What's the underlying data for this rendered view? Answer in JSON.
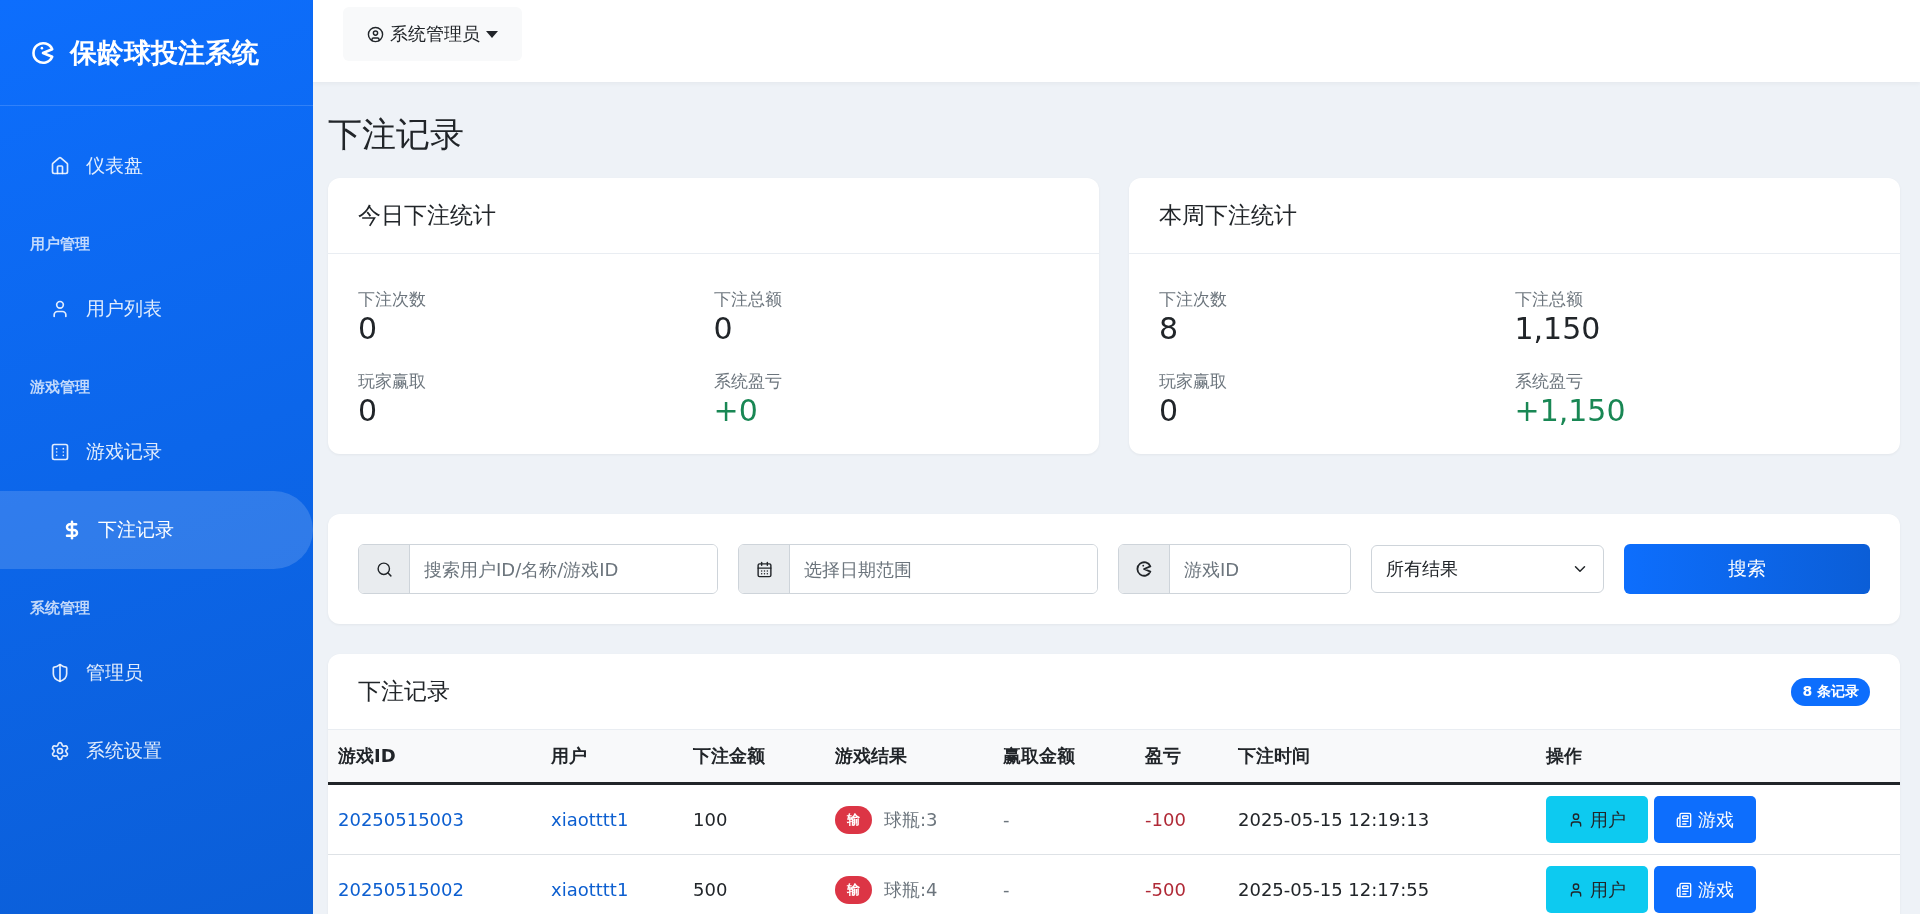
{
  "sidebar": {
    "brand": "保龄球投注系统",
    "sections": [
      {
        "items": [
          {
            "label": "仪表盘",
            "selected": false
          }
        ]
      },
      {
        "heading": "用户管理",
        "items": [
          {
            "label": "用户列表",
            "selected": false
          }
        ]
      },
      {
        "heading": "游戏管理",
        "items": [
          {
            "label": "游戏记录",
            "selected": false
          },
          {
            "label": "下注记录",
            "selected": true
          }
        ]
      },
      {
        "heading": "系统管理",
        "items": [
          {
            "label": "管理员",
            "selected": false
          },
          {
            "label": "系统设置",
            "selected": false
          }
        ]
      }
    ]
  },
  "topbar": {
    "user_menu": "系统管理员"
  },
  "page_title": "下注记录",
  "stat_cards": [
    {
      "title": "今日下注统计",
      "stats": [
        {
          "label": "下注次数",
          "value": "0"
        },
        {
          "label": "下注总额",
          "value": "0"
        },
        {
          "label": "玩家赢取",
          "value": "0"
        },
        {
          "label": "系统盈亏",
          "value": "+0",
          "color": "#198754"
        }
      ]
    },
    {
      "title": "本周下注统计",
      "stats": [
        {
          "label": "下注次数",
          "value": "8"
        },
        {
          "label": "下注总额",
          "value": "1,150"
        },
        {
          "label": "玩家赢取",
          "value": "0"
        },
        {
          "label": "系统盈亏",
          "value": "+1,150",
          "color": "#198754"
        }
      ]
    }
  ],
  "filters": {
    "search": {
      "placeholder": "搜索用户ID/名称/游戏ID"
    },
    "date": {
      "placeholder": "选择日期范围"
    },
    "game_id": {
      "placeholder": "游戏ID"
    },
    "result_select": "所有结果",
    "search_button": "搜索"
  },
  "table": {
    "title": "下注记录",
    "count_badge": "8 条记录",
    "columns": [
      "游戏ID",
      "用户",
      "下注金额",
      "游戏结果",
      "赢取金额",
      "盈亏",
      "下注时间",
      "操作"
    ],
    "rows": [
      {
        "game_id": "20250515003",
        "user": "xiaotttt1",
        "amount": "100",
        "result": {
          "badge": "输",
          "color": "#dc3545",
          "detail": "球瓶:3"
        },
        "win": "-",
        "profit": {
          "text": "-100",
          "color": "#b02a37"
        },
        "time": "2025-05-15 12:19:13",
        "actions": [
          "用户",
          "游戏"
        ]
      },
      {
        "game_id": "20250515002",
        "user": "xiaotttt1",
        "amount": "500",
        "result": {
          "badge": "输",
          "color": "#dc3545",
          "detail": "球瓶:4"
        },
        "win": "-",
        "profit": {
          "text": "-500",
          "color": "#b02a37"
        },
        "time": "2025-05-15 12:17:55",
        "actions": [
          "用户",
          "游戏"
        ]
      }
    ]
  }
}
